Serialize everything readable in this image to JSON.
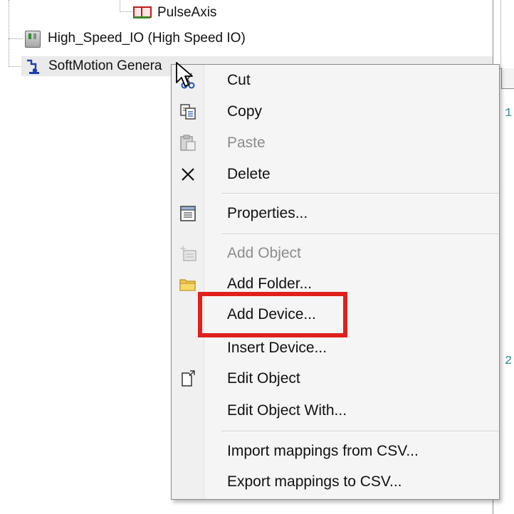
{
  "tree": {
    "nodes": [
      {
        "label": "PulseAxis",
        "icon": "pulse-axis-icon"
      },
      {
        "label": "High_Speed_IO (High Speed IO)",
        "icon": "high-speed-io-icon"
      },
      {
        "label": "SoftMotion Genera",
        "icon": "softmotion-icon"
      }
    ]
  },
  "editor": {
    "line_numbers": [
      "1",
      "2"
    ]
  },
  "context_menu": {
    "items": [
      {
        "label": "Cut",
        "icon": "scissors-icon",
        "enabled": true
      },
      {
        "label": "Copy",
        "icon": "copy-icon",
        "enabled": true
      },
      {
        "label": "Paste",
        "icon": "paste-icon",
        "enabled": false
      },
      {
        "label": "Delete",
        "icon": "delete-x-icon",
        "enabled": true
      },
      {
        "label": "Properties...",
        "icon": "properties-icon",
        "enabled": true
      },
      {
        "label": "Add Object",
        "icon": "add-object-icon",
        "enabled": false
      },
      {
        "label": "Add Folder...",
        "icon": "folder-icon",
        "enabled": true
      },
      {
        "label": "Add Device...",
        "icon": "",
        "enabled": true,
        "highlighted": true
      },
      {
        "label": "Insert Device...",
        "icon": "",
        "enabled": true
      },
      {
        "label": "Edit Object",
        "icon": "edit-object-icon",
        "enabled": true
      },
      {
        "label": "Edit Object With...",
        "icon": "",
        "enabled": true
      },
      {
        "label": "Import mappings from CSV...",
        "icon": "",
        "enabled": true
      },
      {
        "label": "Export mappings to CSV...",
        "icon": "",
        "enabled": true
      }
    ]
  },
  "colors": {
    "highlight": "#e0201c",
    "menu_background": "#f5f5f5",
    "disabled_text": "#8c8c8c",
    "line_number": "#2b8a8a"
  }
}
